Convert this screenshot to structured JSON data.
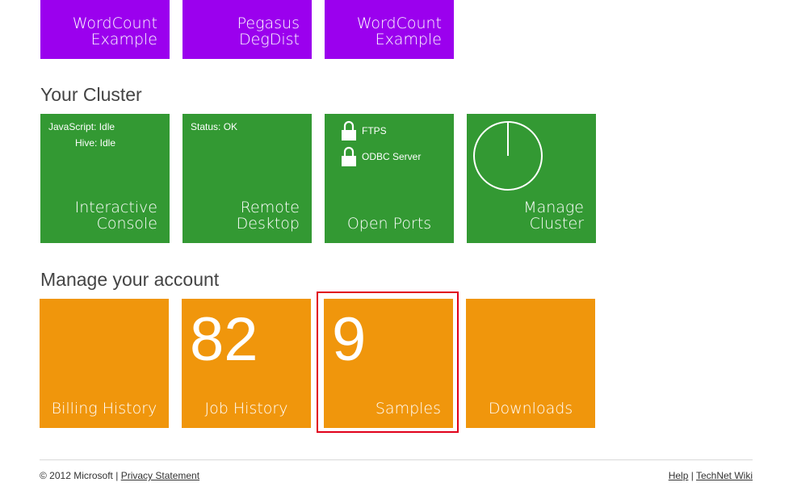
{
  "samples_row": [
    {
      "line1": "WordCount",
      "line2": "Example"
    },
    {
      "line1": "Pegasus",
      "line2": "DegDist"
    },
    {
      "line1": "WordCount",
      "line2": "Example"
    }
  ],
  "cluster": {
    "title": "Your Cluster",
    "interactive": {
      "status1": "JavaScript: Idle",
      "status2": "Hive: Idle",
      "line1": "Interactive",
      "line2": "Console"
    },
    "remote": {
      "status": "Status: OK",
      "line1": "Remote",
      "line2": "Desktop"
    },
    "ports": {
      "port1": "FTPS",
      "port2": "ODBC Server",
      "label": "Open Ports"
    },
    "manage": {
      "line1": "Manage",
      "line2": "Cluster"
    }
  },
  "account": {
    "title": "Manage your account",
    "billing": {
      "label": "Billing History"
    },
    "jobs": {
      "count": "82",
      "label": "Job History"
    },
    "samples": {
      "count": "9",
      "label": "Samples"
    },
    "downloads": {
      "label": "Downloads"
    }
  },
  "footer": {
    "copyright": "© 2012 Microsoft |",
    "privacy": "Privacy Statement",
    "help": "Help",
    "sep": "|",
    "technet": "TechNet Wiki"
  },
  "colors": {
    "purple": "#9b00ee",
    "green": "#339933",
    "orange": "#f0960c",
    "selection": "#e0001a"
  }
}
